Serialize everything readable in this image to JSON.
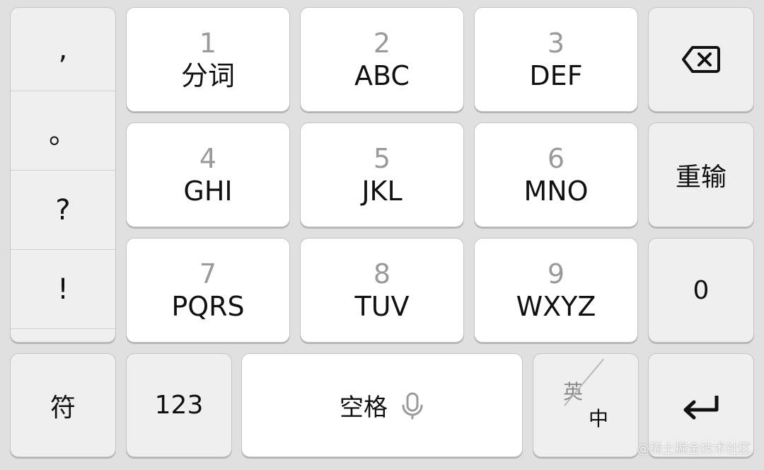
{
  "punctuation": [
    ",",
    "。",
    "?",
    "!"
  ],
  "keys": [
    {
      "name": "key-1",
      "num": "1",
      "label": "分词"
    },
    {
      "name": "key-2",
      "num": "2",
      "label": "ABC"
    },
    {
      "name": "key-3",
      "num": "3",
      "label": "DEF"
    },
    {
      "name": "key-4",
      "num": "4",
      "label": "GHI"
    },
    {
      "name": "key-5",
      "num": "5",
      "label": "JKL"
    },
    {
      "name": "key-6",
      "num": "6",
      "label": "MNO"
    },
    {
      "name": "key-7",
      "num": "7",
      "label": "PQRS"
    },
    {
      "name": "key-8",
      "num": "8",
      "label": "TUV"
    },
    {
      "name": "key-9",
      "num": "9",
      "label": "WXYZ"
    }
  ],
  "right_keys": {
    "backspace_icon": "backspace-icon",
    "retype": "重输",
    "zero": "0",
    "enter_icon": "enter-icon"
  },
  "bottom": {
    "symbol": "符",
    "numbers": "123",
    "space": "空格",
    "mic_icon": "microphone-icon",
    "lang_en": "英",
    "lang_zh": "中"
  },
  "watermark": "@稀土掘金技术社区"
}
